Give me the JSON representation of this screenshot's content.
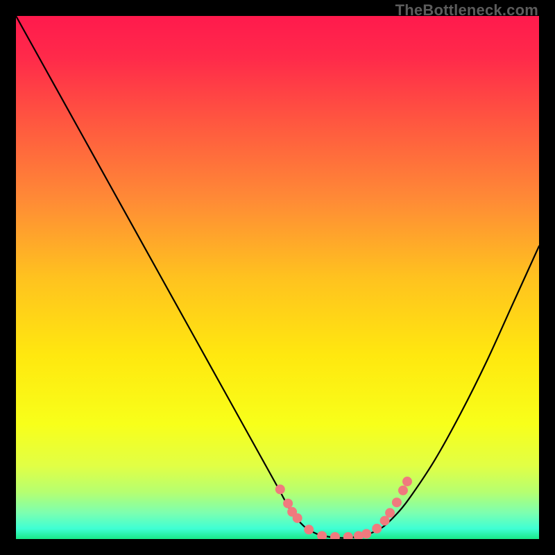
{
  "watermark": "TheBottleneck.com",
  "chart_data": {
    "type": "line",
    "title": "",
    "xlabel": "",
    "ylabel": "",
    "xlim": [
      0,
      1
    ],
    "ylim": [
      0,
      1
    ],
    "background_gradient_stops": [
      {
        "offset": 0.0,
        "color": "#ff1a4d"
      },
      {
        "offset": 0.08,
        "color": "#ff2a4a"
      },
      {
        "offset": 0.2,
        "color": "#ff5640"
      },
      {
        "offset": 0.35,
        "color": "#ff8a36"
      },
      {
        "offset": 0.5,
        "color": "#ffc21f"
      },
      {
        "offset": 0.65,
        "color": "#ffe80f"
      },
      {
        "offset": 0.78,
        "color": "#f8ff1a"
      },
      {
        "offset": 0.86,
        "color": "#e1ff45"
      },
      {
        "offset": 0.91,
        "color": "#b6ff70"
      },
      {
        "offset": 0.95,
        "color": "#7cffb0"
      },
      {
        "offset": 0.98,
        "color": "#3fffd4"
      },
      {
        "offset": 1.0,
        "color": "#19e988"
      }
    ],
    "series": [
      {
        "name": "bottleneck-curve",
        "stroke": "#000000",
        "stroke_width": 2.2,
        "x": [
          0.0,
          0.05,
          0.1,
          0.15,
          0.2,
          0.25,
          0.3,
          0.35,
          0.4,
          0.45,
          0.5,
          0.525,
          0.55,
          0.575,
          0.6,
          0.625,
          0.65,
          0.675,
          0.7,
          0.725,
          0.75,
          0.8,
          0.85,
          0.9,
          0.95,
          1.0
        ],
        "y": [
          1.0,
          0.91,
          0.82,
          0.73,
          0.64,
          0.55,
          0.46,
          0.37,
          0.28,
          0.19,
          0.1,
          0.055,
          0.025,
          0.01,
          0.004,
          0.002,
          0.004,
          0.01,
          0.022,
          0.045,
          0.075,
          0.15,
          0.24,
          0.34,
          0.45,
          0.56
        ]
      }
    ],
    "markers": {
      "name": "highlight-dots",
      "fill": "#f07a7e",
      "stroke": "#f07a7e",
      "radius": 6.5,
      "x": [
        0.505,
        0.52,
        0.528,
        0.538,
        0.56,
        0.585,
        0.61,
        0.635,
        0.655,
        0.67,
        0.69,
        0.705,
        0.715,
        0.728,
        0.74,
        0.748
      ],
      "y": [
        0.095,
        0.068,
        0.052,
        0.04,
        0.018,
        0.006,
        0.004,
        0.004,
        0.006,
        0.01,
        0.02,
        0.035,
        0.05,
        0.07,
        0.093,
        0.11
      ]
    }
  }
}
